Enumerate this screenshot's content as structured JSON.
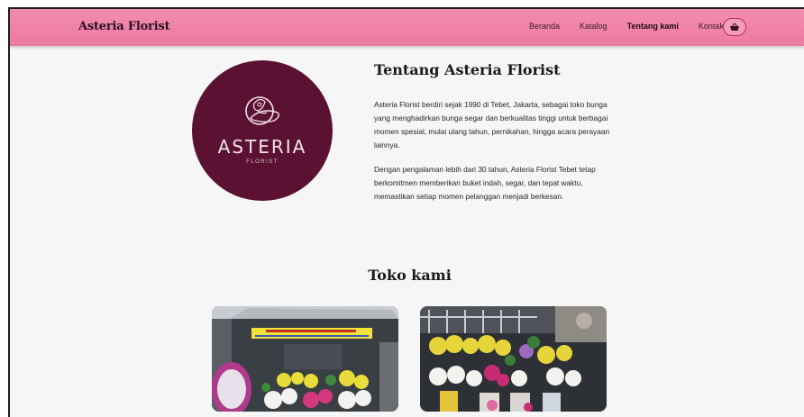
{
  "navbar": {
    "brand": "Asteria Florist",
    "links": [
      {
        "label": "Beranda",
        "active": false
      },
      {
        "label": "Katalog",
        "active": false
      },
      {
        "label": "Tentang kami",
        "active": true
      },
      {
        "label": "Kontak",
        "active": false
      }
    ],
    "cart_icon": "basket-icon"
  },
  "about": {
    "logo_word": "ASTERIA",
    "logo_sub": "FLORIST",
    "title": "Tentang Asteria Florist",
    "paragraph1": "Asteria Florist berdiri sejak 1990 di Tebet, Jakarta, sebagai toko bunga yang menghadirkan bunga segar dan berkualitas tinggi untuk berbagai momen spesial, mulai ulang tahun, pernikahan, hingga acara perayaan lainnya.",
    "paragraph2": "Dengan pengalaman lebih dari 30 tahun, Asteria Florist Tebet tetap berkomitmen memberikan buket indah, segar, dan tepat waktu, memastikan setiap momen pelanggan menjadi berkesan."
  },
  "store": {
    "title": "Toko kami",
    "photos": [
      "store-photo-front",
      "store-photo-flowers"
    ]
  },
  "colors": {
    "navbar": "#ef82a8",
    "logo_bg": "#5b1131",
    "page_bg": "#f7f6f6"
  }
}
